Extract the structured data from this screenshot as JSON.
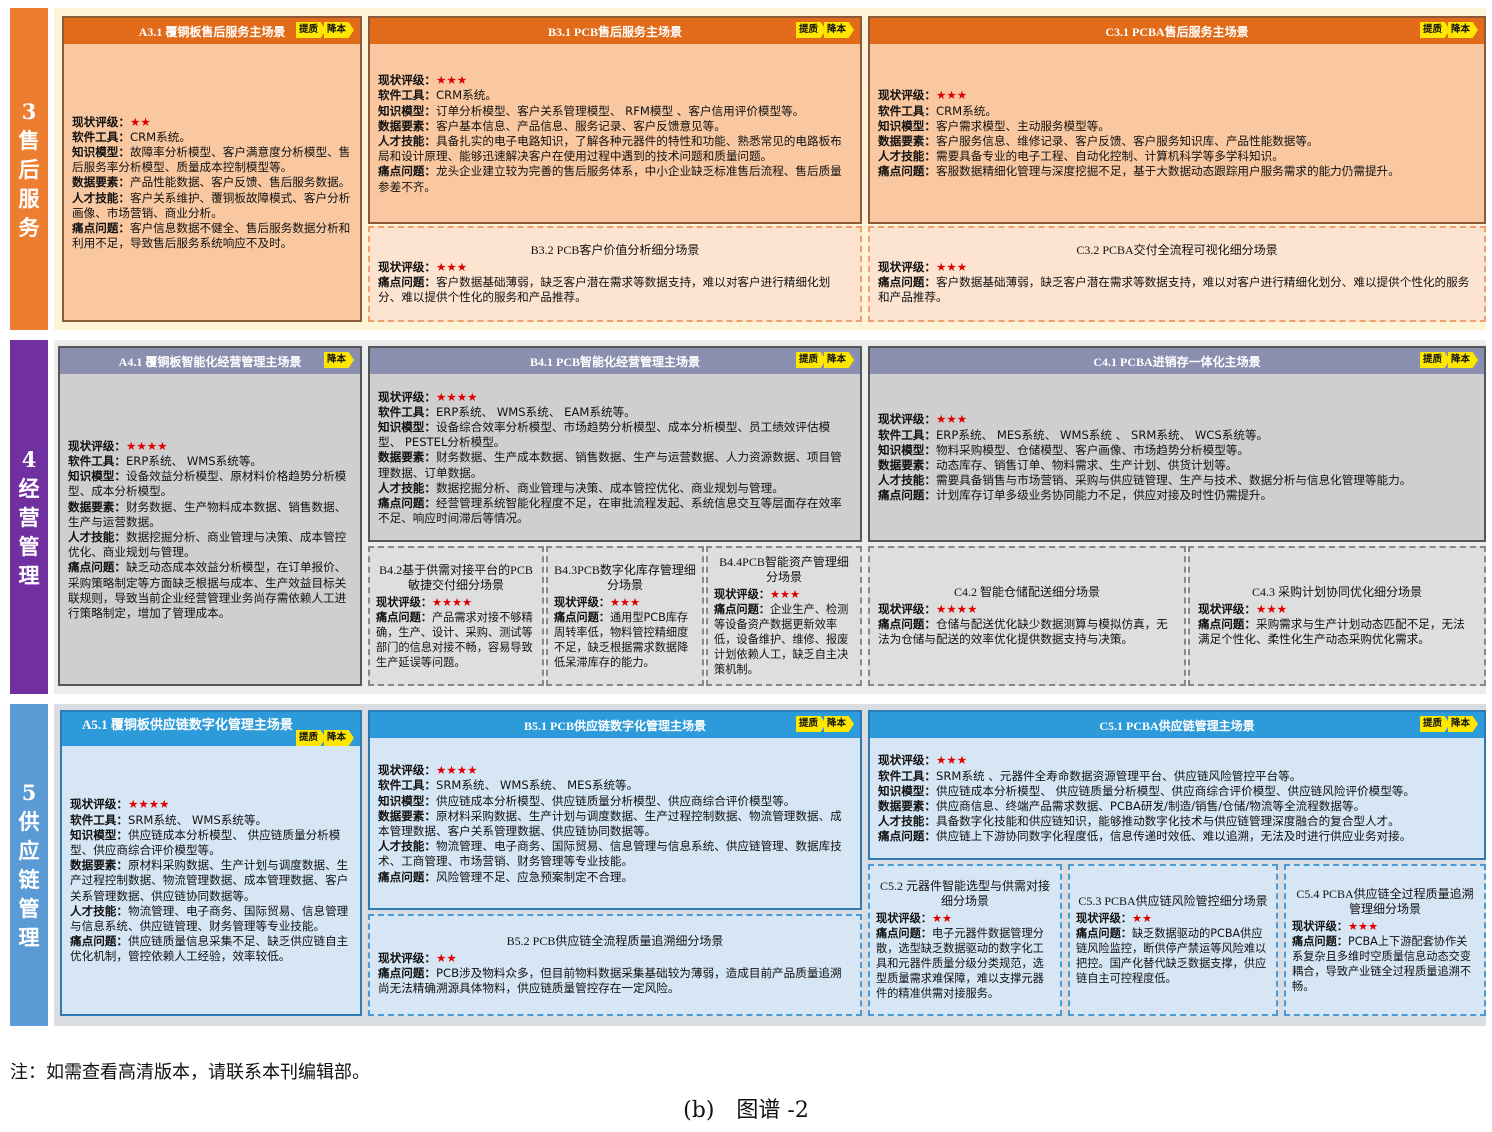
{
  "colors": {
    "s3": "#ed7d31",
    "s4": "#7030a0",
    "s5": "#5b9bd5"
  },
  "sections": [
    {
      "bar": {
        "num": "3",
        "chars": [
          "售",
          "后",
          "服",
          "务"
        ]
      },
      "main": [
        {
          "title": "A3.1 覆铜板售后服务主场景",
          "tags": [
            "提质",
            "降本"
          ],
          "lines": [
            {
              "k": "现状评级：",
              "v": "",
              "stars": "★★"
            },
            {
              "k": "软件工具：",
              "v": "CRM系统。"
            },
            {
              "k": "知识模型：",
              "v": "故障率分析模型、客户满意度分析模型、售后服务率分析模型、质量成本控制模型等。"
            },
            {
              "k": "数据要素：",
              "v": "产品性能数据、客户反馈、售后服务数据。"
            },
            {
              "k": "人才技能：",
              "v": "客户关系维护、覆铜板故障模式、客户分析画像、市场营销、商业分析。"
            },
            {
              "k": "痛点问题：",
              "v": "客户信息数据不健全、售后服务数据分析和利用不足，导致售后服务系统响应不及时。"
            }
          ]
        },
        {
          "title": "B3.1 PCB售后服务主场景",
          "tags": [
            "提质",
            "降本"
          ],
          "lines": [
            {
              "k": "现状评级：",
              "v": "",
              "stars": "★★★"
            },
            {
              "k": "软件工具：",
              "v": "CRM系统。"
            },
            {
              "k": "知识模型：",
              "v": "订单分析模型、客户关系管理模型、 RFM模型 、客户信用评价模型等。"
            },
            {
              "k": "数据要素：",
              "v": "客户基本信息、产品信息、服务记录、客户反馈意见等。"
            },
            {
              "k": "人才技能：",
              "v": "具备扎实的电子电路知识，了解各种元器件的特性和功能、熟悉常见的电路板布局和设计原理、能够迅速解决客户在使用过程中遇到的技术问题和质量问题。"
            },
            {
              "k": "痛点问题：",
              "v": "龙头企业建立较为完善的售后服务体系，中小企业缺乏标准售后流程、售后质量参差不齐。"
            }
          ]
        },
        {
          "title": "C3.1 PCBA售后服务主场景",
          "tags": [
            "提质",
            "降本"
          ],
          "lines": [
            {
              "k": "现状评级：",
              "v": "",
              "stars": "★★★"
            },
            {
              "k": "软件工具：",
              "v": "CRM系统。"
            },
            {
              "k": "知识模型：",
              "v": "客户需求模型、主动服务模型等。"
            },
            {
              "k": "数据要素：",
              "v": "客户服务信息、维修记录、客户反馈、客户服务知识库、产品性能数据等。"
            },
            {
              "k": "人才技能：",
              "v": "需要具备专业的电子工程、自动化控制、计算机科学等多学科知识。"
            },
            {
              "k": "痛点问题：",
              "v": "客服数据精细化管理与深度挖掘不足，基于大数据动态跟踪用户服务需求的能力仍需提升。"
            }
          ]
        }
      ],
      "subs": [
        {
          "title": "B3.2 PCB客户价值分析细分场景",
          "lines": [
            {
              "k": "现状评级：",
              "v": "",
              "stars": "★★★"
            },
            {
              "k": "痛点问题：",
              "v": "客户数据基础薄弱，缺乏客户潜在需求等数据支持，难以对客户进行精细化划分、难以提供个性化的服务和产品推荐。"
            }
          ]
        },
        {
          "title": "C3.2 PCBA交付全流程可视化细分场景",
          "lines": [
            {
              "k": "现状评级：",
              "v": "",
              "stars": "★★★"
            },
            {
              "k": "痛点问题：",
              "v": "客户数据基础薄弱，缺乏客户潜在需求等数据支持，难以对客户进行精细化划分、难以提供个性化的服务和产品推荐。"
            }
          ]
        }
      ]
    },
    {
      "bar": {
        "num": "4",
        "chars": [
          "经",
          "营",
          "管",
          "理"
        ]
      },
      "main": [
        {
          "title": "A4.1 覆铜板智能化经营管理主场景",
          "tags": [
            "降本"
          ],
          "lines": [
            {
              "k": "现状评级：",
              "v": "",
              "stars": "★★★★"
            },
            {
              "k": "软件工具：",
              "v": "ERP系统、 WMS系统等。"
            },
            {
              "k": "知识模型：",
              "v": "设备效益分析模型、原材料价格趋势分析模型、成本分析模型。"
            },
            {
              "k": "数据要素：",
              "v": "财务数据、生产物料成本数据、销售数据、生产与运营数据。"
            },
            {
              "k": "人才技能：",
              "v": "数据挖掘分析、商业管理与决策、成本管控优化、商业规划与管理。"
            },
            {
              "k": "痛点问题：",
              "v": "缺乏动态成本效益分析模型，在订单报价、采购策略制定等方面缺乏根据与成本、生产效益目标关联规则，导致当前企业经营管理业务尚存需依赖人工进行策略制定，增加了管理成本。"
            }
          ]
        },
        {
          "title": "B4.1 PCB智能化经营管理主场景",
          "tags": [
            "提质",
            "降本"
          ],
          "lines": [
            {
              "k": "现状评级：",
              "v": "",
              "stars": "★★★★"
            },
            {
              "k": "软件工具：",
              "v": "ERP系统、 WMS系统、 EAM系统等。"
            },
            {
              "k": "知识模型：",
              "v": "设备综合效率分析模型、市场趋势分析模型、成本分析模型、员工绩效评估模型、 PESTEL分析模型。"
            },
            {
              "k": "数据要素：",
              "v": "财务数据、生产成本数据、销售数据、生产与运营数据、人力资源数据、项目管理数据、订单数据。"
            },
            {
              "k": "人才技能：",
              "v": "数据挖掘分析、商业管理与决策、成本管控优化、商业规划与管理。"
            },
            {
              "k": "痛点问题：",
              "v": "经营管理系统智能化程度不足，在审批流程发起、系统信息交互等层面存在效率不足、响应时间滞后等情况。"
            }
          ]
        },
        {
          "title": "C4.1 PCBA进销存一体化主场景",
          "tags": [
            "提质",
            "降本"
          ],
          "lines": [
            {
              "k": "现状评级：",
              "v": "",
              "stars": "★★★"
            },
            {
              "k": "软件工具：",
              "v": "ERP系统、 MES系统、 WMS系统 、 SRM系统、 WCS系统等。"
            },
            {
              "k": "知识模型：",
              "v": "物料采购模型、仓储模型、客户画像、市场趋势分析模型等。"
            },
            {
              "k": "数据要素：",
              "v": "动态库存、销售订单、物料需求、生产计划、供货计划等。"
            },
            {
              "k": "人才技能：",
              "v": "需要具备销售与市场营销、采购与供应链管理、生产与技术、数据分析与信息化管理等能力。"
            },
            {
              "k": "痛点问题：",
              "v": "计划库存订单多级业务协同能力不足，供应对接及时性仍需提升。"
            }
          ]
        }
      ],
      "subs": [
        {
          "title": "B4.2基于供需对接平台的PCB敏捷交付细分场景",
          "lines": [
            {
              "k": "现状评级：",
              "v": "",
              "stars": "★★★★"
            },
            {
              "k": "痛点问题：",
              "v": "产品需求对接不够精确，生产、设计、采购、测试等部门的信息对接不畅，容易导致生产延误等问题。"
            }
          ]
        },
        {
          "title": "B4.3PCB数字化库存管理细分场景",
          "lines": [
            {
              "k": "现状评级：",
              "v": "",
              "stars": "★★★"
            },
            {
              "k": "痛点问题：",
              "v": "通用型PCB库存周转率低，物料管控精细度不足，缺乏根据需求数据降低呆滞库存的能力。"
            }
          ]
        },
        {
          "title": "B4.4PCB智能资产管理细分场景",
          "lines": [
            {
              "k": "现状评级：",
              "v": "",
              "stars": "★★★"
            },
            {
              "k": "痛点问题：",
              "v": "企业生产、检测等设备资产数据更新效率低，设备维护、维修、报废计划依赖人工，缺乏自主决策机制。"
            }
          ]
        },
        {
          "title": "C4.2 智能仓储配送细分场景",
          "lines": [
            {
              "k": "现状评级：",
              "v": "",
              "stars": "★★★★"
            },
            {
              "k": "痛点问题：",
              "v": "仓储与配送优化缺少数据测算与模拟仿真，无法为仓储与配送的效率优化提供数据支持与决策。"
            }
          ]
        },
        {
          "title": "C4.3 采购计划协同优化细分场景",
          "lines": [
            {
              "k": "现状评级：",
              "v": "",
              "stars": "★★★"
            },
            {
              "k": "痛点问题：",
              "v": "采购需求与生产计划动态匹配不足，无法满足个性化、柔性化生产动态采购优化需求。"
            }
          ]
        }
      ]
    },
    {
      "bar": {
        "num": "5",
        "chars": [
          "供",
          "应",
          "链",
          "管",
          "理"
        ]
      },
      "main": [
        {
          "title": "A5.1 覆铜板供应链数字化管理主场景",
          "tags": [
            "提质",
            "降本"
          ],
          "lines": [
            {
              "k": "现状评级：",
              "v": "",
              "stars": "★★★★"
            },
            {
              "k": "软件工具：",
              "v": "SRM系统、 WMS系统等。"
            },
            {
              "k": "知识模型：",
              "v": "供应链成本分析模型、 供应链质量分析模型、供应商综合评价模型等。"
            },
            {
              "k": "数据要素：",
              "v": "原材料采购数据、生产计划与调度数据、生产过程控制数据、物流管理数据、成本管理数据、客户关系管理数据、供应链协同数据等。"
            },
            {
              "k": "人才技能：",
              "v": "物流管理、电子商务、国际贸易、信息管理与信息系统、供应链管理、财务管理等专业技能。"
            },
            {
              "k": "痛点问题：",
              "v": "供应链质量信息采集不足、缺乏供应链自主优化机制，管控依赖人工经验，效率较低。"
            }
          ]
        },
        {
          "title": "B5.1 PCB供应链数字化管理主场景",
          "tags": [
            "提质",
            "降本"
          ],
          "lines": [
            {
              "k": "现状评级：",
              "v": "",
              "stars": "★★★★"
            },
            {
              "k": "软件工具：",
              "v": "SRM系统、 WMS系统、 MES系统等。"
            },
            {
              "k": "知识模型：",
              "v": "供应链成本分析模型、供应链质量分析模型、供应商综合评价模型等。"
            },
            {
              "k": "数据要素：",
              "v": "原材料采购数据、生产计划与调度数据、生产过程控制数据、物流管理数据、成本管理数据、客户关系管理数据、供应链协同数据等。"
            },
            {
              "k": "人才技能：",
              "v": "物流管理、电子商务、国际贸易、信息管理与信息系统、供应链管理、数据库技术、工商管理、市场营销、财务管理等专业技能。"
            },
            {
              "k": "痛点问题：",
              "v": "风险管理不足、应急预案制定不合理。"
            }
          ]
        },
        {
          "title": "C5.1 PCBA供应链管理主场景",
          "tags": [
            "提质",
            "降本"
          ],
          "lines": [
            {
              "k": "现状评级：",
              "v": "",
              "stars": "★★★"
            },
            {
              "k": "软件工具：",
              "v": "SRM系统 、元器件全寿命数据资源管理平台、供应链风险管控平台等。"
            },
            {
              "k": "知识模型：",
              "v": "供应链成本分析模型、 供应链质量分析模型、供应商综合评价模型、供应链风险评价模型等。"
            },
            {
              "k": "数据要素：",
              "v": "供应商信息、终端产品需求数据、PCBA研发/制造/销售/仓储/物流等全流程数据等。"
            },
            {
              "k": "人才技能：",
              "v": "具备数字化技能和供应链知识，能够推动数字化技术与供应链管理深度融合的复合型人才。"
            },
            {
              "k": "痛点问题：",
              "v": "供应链上下游协同数字化程度低，信息传递时效低、难以追溯，无法及时进行供应业务对接。"
            }
          ]
        }
      ],
      "subs": [
        {
          "title": "B5.2 PCB供应链全流程质量追溯细分场景",
          "lines": [
            {
              "k": "现状评级：",
              "v": "",
              "stars": "★★"
            },
            {
              "k": "痛点问题：",
              "v": "PCB涉及物料众多，但目前物料数据采集基础较为薄弱，造成目前产品质量追溯尚无法精确溯源具体物料，供应链质量管控存在一定风险。"
            }
          ]
        },
        {
          "title": "C5.2 元器件智能选型与供需对接细分场景",
          "lines": [
            {
              "k": "现状评级：",
              "v": "",
              "stars": "★★"
            },
            {
              "k": "痛点问题：",
              "v": "电子元器件数据管理分散，选型缺乏数据驱动的数字化工具和元器件质量分级分类规范，选型质量需求难保障，难以支撑元器件的精准供需对接服务。"
            }
          ]
        },
        {
          "title": "C5.3 PCBA供应链风险管控细分场景",
          "lines": [
            {
              "k": "现状评级：",
              "v": "",
              "stars": "★★"
            },
            {
              "k": "痛点问题：",
              "v": "缺乏数据驱动的PCBA供应链风险监控，断供停产禁运等风险难以把控。国产化替代缺乏数据支撑，供应链自主可控程度低。"
            }
          ]
        },
        {
          "title": "C5.4 PCBA供应链全过程质量追溯管理细分场景",
          "lines": [
            {
              "k": "现状评级：",
              "v": "",
              "stars": "★★★"
            },
            {
              "k": "痛点问题：",
              "v": "PCBA上下游配套协作关系复杂且多维时空质量信息动态交变耦合，导致产业链全过程质量追溯不畅。"
            }
          ]
        }
      ]
    }
  ],
  "note": "注：如需查看高清版本，请联系本刊编辑部。",
  "caption": "(b)　图谱 -2"
}
